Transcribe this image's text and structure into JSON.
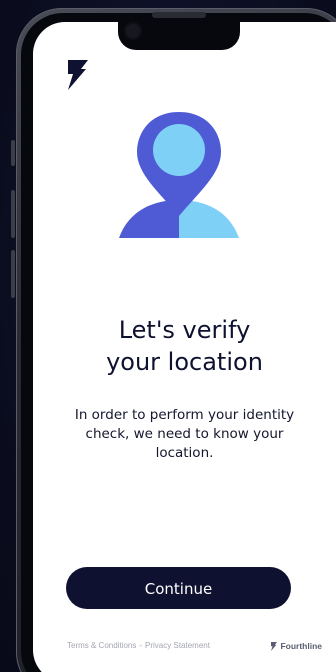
{
  "screen": {
    "title_line1": "Let's verify",
    "title_line2": "your location",
    "description": "In order to perform your identity check, we need to know your location.",
    "continue_label": "Continue"
  },
  "footer": {
    "terms_label": "Terms & Conditions",
    "separator": "-",
    "privacy_label": "Privacy Statement",
    "brand_name": "Fourthline"
  },
  "icons": {
    "logo": "fourthline-logo-icon",
    "illustration": "location-person-pin-icon"
  },
  "colors": {
    "primary": "#0f1130",
    "pin": "#4f5bd5",
    "head": "#7fd0f7",
    "shoulder_right": "#7fd0f7",
    "shoulder_left": "#4f5bd5",
    "background": "#ffffff"
  }
}
